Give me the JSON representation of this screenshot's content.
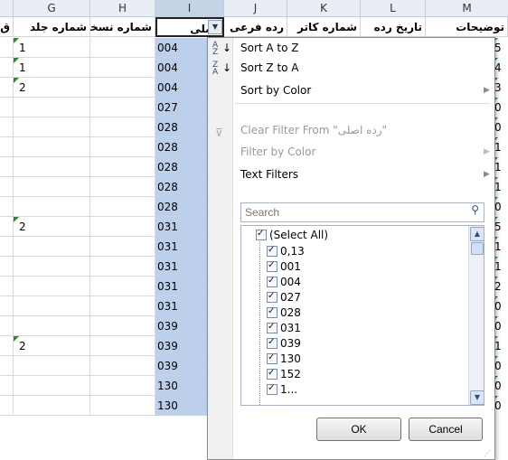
{
  "columns": {
    "letters": [
      "G",
      "H",
      "I",
      "J",
      "K",
      "L",
      "M"
    ],
    "left_partial_header": "ق",
    "headers": {
      "G": "شماره جلد",
      "H": "شماره نسخه",
      "I": "اصلی",
      "J": "رده فرعی",
      "K": "شماره کاتر",
      "L": "تاریخ رده",
      "M": "توضیحات"
    }
  },
  "rows": [
    {
      "g": "1",
      "i": "004",
      "r": "5"
    },
    {
      "g": "1",
      "i": "004",
      "r": "4"
    },
    {
      "g": "2",
      "i": "004",
      "r": "3"
    },
    {
      "g": "",
      "i": "027",
      "r": "0"
    },
    {
      "g": "",
      "i": "028",
      "r": "0"
    },
    {
      "g": "",
      "i": "028",
      "r": "1"
    },
    {
      "g": "",
      "i": "028",
      "r": "1"
    },
    {
      "g": "",
      "i": "028",
      "r": "1"
    },
    {
      "g": "",
      "i": "028",
      "r": "0"
    },
    {
      "g": "2",
      "i": "031",
      "r": "5"
    },
    {
      "g": "",
      "i": "031",
      "r": "1"
    },
    {
      "g": "",
      "i": "031",
      "r": "1"
    },
    {
      "g": "",
      "i": "031",
      "r": "2"
    },
    {
      "g": "",
      "i": "031",
      "r": "0"
    },
    {
      "g": "",
      "i": "039",
      "r": "0"
    },
    {
      "g": "2",
      "i": "039",
      "r": "1"
    },
    {
      "g": "",
      "i": "039",
      "r": "0"
    },
    {
      "g": "",
      "i": "130",
      "r": "0"
    },
    {
      "g": "",
      "i": "130",
      "r": "0"
    }
  ],
  "filter_menu": {
    "sort_a_to_z": "Sort A to Z",
    "sort_z_to_a": "Sort Z to A",
    "sort_by_color": "Sort by Color",
    "clear_filter": "Clear Filter From \"رده اصلی\"",
    "filter_by_color": "Filter by Color",
    "text_filters": "Text Filters",
    "search_placeholder": "Search",
    "select_all": "(Select All)",
    "values": [
      "0,13",
      "001",
      "004",
      "027",
      "028",
      "031",
      "039",
      "130",
      "152",
      "1..."
    ],
    "ok": "OK",
    "cancel": "Cancel"
  },
  "colors": {
    "selected_column": "#bcd0ec",
    "header_strip": "#e9eef5",
    "error_triangle": "#2a8a32"
  }
}
